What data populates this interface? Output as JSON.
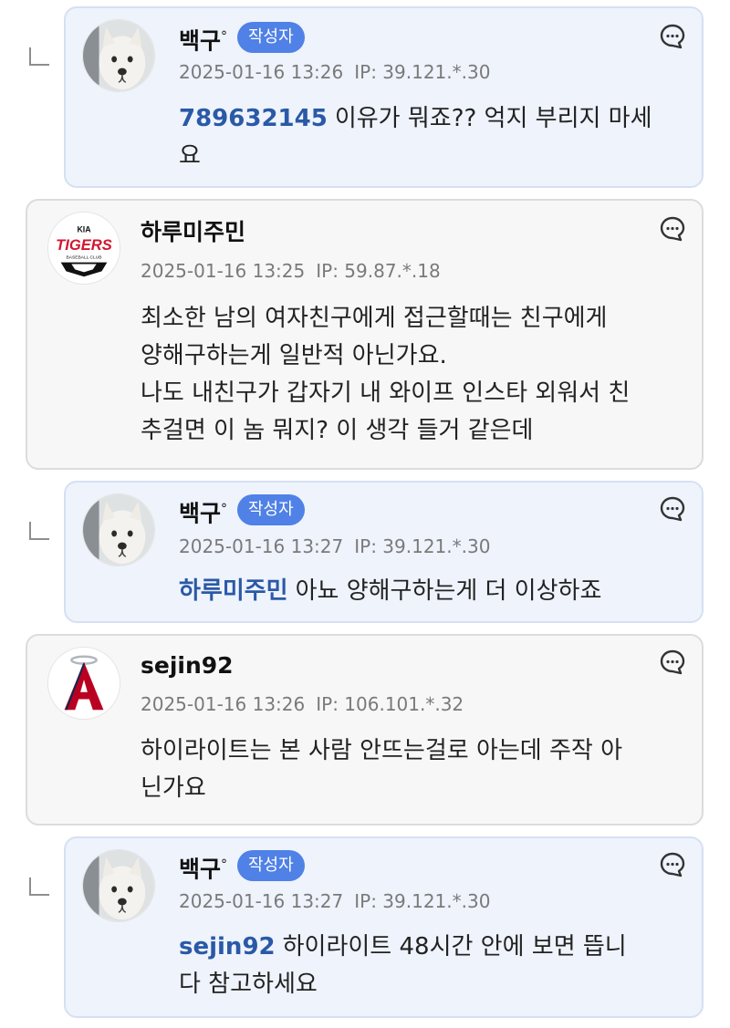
{
  "comments": [
    {
      "type": "reply",
      "author": "백구",
      "author_deco": "°",
      "badge": "작성자",
      "date": "2025-01-16 13:26",
      "ip": "IP: 39.121.*.30",
      "mention": "789632145",
      "lines": [
        "이유가 뭐죠?? 억지 부리지 마세",
        "요"
      ],
      "avatar": "dog-avatar",
      "icon": "comment-bubble-icon"
    },
    {
      "type": "comment",
      "author": "하루미주민",
      "date": "2025-01-16 13:25",
      "ip": "IP: 59.87.*.18",
      "lines": [
        "최소한 남의 여자친구에게 접근할때는 친구에게",
        "양해구하는게 일반적 아닌가요.",
        "나도 내친구가 갑자기 내 와이프 인스타 외워서 친",
        "추걸면 이 놈 뭐지? 이 생각 들거 같은데"
      ],
      "avatar": "tigers-logo-avatar",
      "avatar_text": "TIGERS",
      "avatar_sub": "BASEBALL CLUB",
      "icon": "comment-bubble-icon"
    },
    {
      "type": "reply",
      "author": "백구",
      "author_deco": "°",
      "badge": "작성자",
      "date": "2025-01-16 13:27",
      "ip": "IP: 39.121.*.30",
      "mention": "하루미주민",
      "lines": [
        "아뇨 양해구하는게 더 이상하죠"
      ],
      "avatar": "dog-avatar",
      "icon": "comment-bubble-icon"
    },
    {
      "type": "comment",
      "author": "sejin92",
      "date": "2025-01-16 13:26",
      "ip": "IP: 106.101.*.32",
      "lines": [
        "하이라이트는 본 사람 안뜨는걸로 아는데 주작 아",
        "닌가요"
      ],
      "avatar": "angels-logo-avatar",
      "icon": "comment-bubble-icon"
    },
    {
      "type": "reply",
      "author": "백구",
      "author_deco": "°",
      "badge": "작성자",
      "date": "2025-01-16 13:27",
      "ip": "IP: 39.121.*.30",
      "mention": "sejin92",
      "lines": [
        "하이라이트 48시간 안에 보면 뜹니",
        "다 참고하세요"
      ],
      "avatar": "dog-avatar",
      "icon": "comment-bubble-icon"
    }
  ],
  "colors": {
    "badge": "#4f81e6",
    "mention": "#2a59a6",
    "reply_bg": "#eef3fc",
    "comment_bg": "#f7f7f7",
    "meta": "#7a7a7a"
  }
}
